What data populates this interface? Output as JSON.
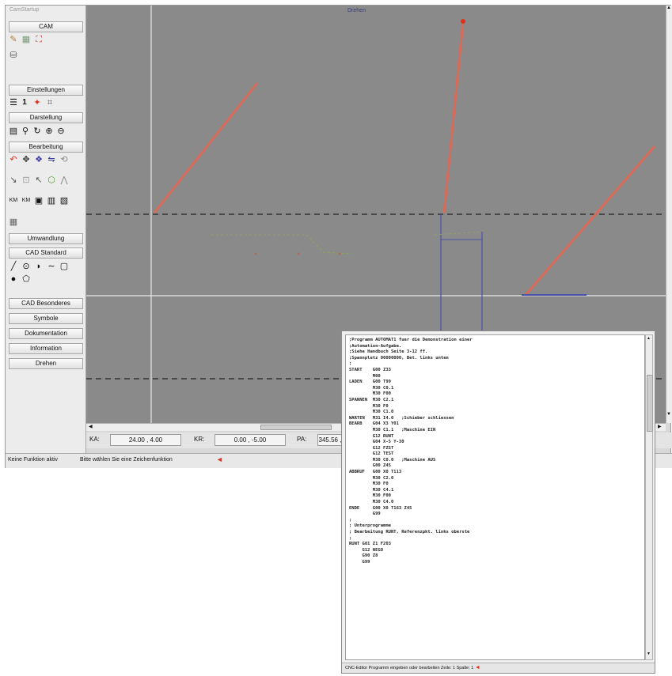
{
  "sidebar": {
    "title": "CamStartup",
    "cam_button": "CAM",
    "einstellungen": "Einstellungen",
    "darstellung": "Darstellung",
    "bearbeitung": "Bearbeitung",
    "umwandlung": "Umwandlung",
    "cad_standard": "CAD Standard",
    "cad_besonderes": "CAD Besonderes",
    "symbole": "Symbole",
    "dokumentation": "Dokumentation",
    "information": "Information",
    "drehen": "Drehen",
    "einstellungen_value": "1"
  },
  "canvas": {
    "title": "Drehen"
  },
  "coords": {
    "ka_label": "KA:",
    "ka_value": "24.00 , 4.00",
    "kr_label": "KR:",
    "kr_value": "0.00 , -5.00",
    "pa_label": "PA:",
    "pa_value": "345.56 ,"
  },
  "status": {
    "left": "Keine Funktion aktiv",
    "right": "Bitte wählen Sie eine Zeichenfunktion"
  },
  "cnc": {
    "code": [
      ";Programm AUTOMAT1 fuer die Demonstration einer",
      ";Automation-Aufgabe.",
      ";Siehe Handbuch Seite 3-12 ff.",
      ";Spannpletz 00000000, Bet. links unten",
      ";",
      "START    G00 Z33",
      "         M00",
      "LADEN    G00 T99",
      "         M30 C0.1",
      "         M30 F00",
      "SPANNEN  M30 C2.1",
      "         M30 F0",
      "         M30 C1.0",
      "WARTEN   M31 I4.0   ;Schieber schliessen",
      "BEARB    G04 X3 Y01",
      "         M30 C1.1   ;Maschine EIN",
      "         G12 RUNT",
      "         G04 X-5 Y-30",
      "         G12 FZST",
      "         G12 TEST",
      "         M30 C0.0   ;Maschine AUS",
      "         G00 Z45",
      "ABBRUF   G00 X0 T113",
      "         M30 C2.0",
      "         M30 F0",
      "         M30 C4.1",
      "         M30 F00",
      "         M30 C4.0",
      "ENDE     G00 X0 T163 Z45",
      "         G99",
      ";",
      "; Unterprogramme",
      "; Bearbeitung RUNT, Referenzpkt. links oberste",
      ";",
      "RUNT G01 Z1 F203",
      "     G12 NEGO",
      "     G90 Z8",
      "     G99"
    ],
    "status": "CNC-Editor   Programm eingeben oder bearbeiten   Zeile: 1   Spalte: 1"
  }
}
